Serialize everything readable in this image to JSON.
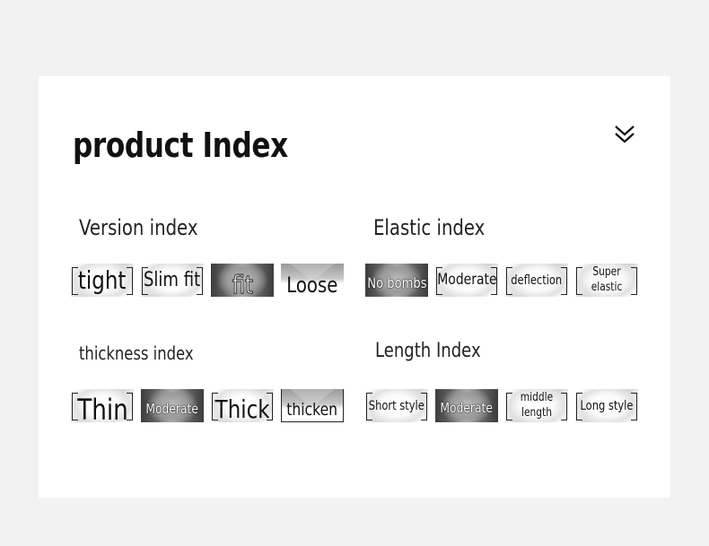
{
  "page": {
    "title": "product Index"
  },
  "header": {
    "collapse_icon": "double-chevron-down-icon"
  },
  "sections": [
    {
      "title": "Version index",
      "options": [
        "tight",
        "Slim fit",
        "fit",
        "Loose"
      ]
    },
    {
      "title": "Elastic index",
      "options": [
        "No bombs",
        "Moderate",
        "deflection",
        "Super elastic"
      ]
    },
    {
      "title": "thickness index",
      "options": [
        "Thin",
        "Moderate",
        "Thick",
        "thicken"
      ]
    },
    {
      "title": "Length Index",
      "options": [
        "Short style",
        "Moderate",
        "middle length",
        "Long style"
      ]
    }
  ],
  "colors": {
    "background": "#f2f2f2",
    "card": "#ffffff",
    "text": "#111111",
    "frame": "#222222"
  }
}
